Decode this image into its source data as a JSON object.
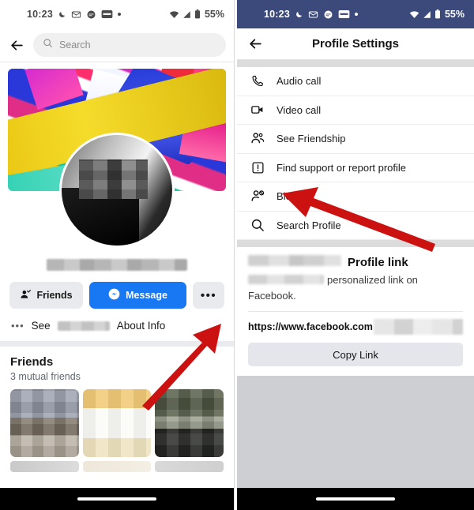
{
  "meta": {
    "accent_blue": "#1877f2",
    "status_bar_dark": "#3b4a7a",
    "arrow_red": "#cc1111",
    "button_gray": "#e4e6eb"
  },
  "status_bar": {
    "time": "10:23",
    "battery_percent": "55%",
    "icons_left": [
      "do-not-disturb-moon-icon",
      "email-icon",
      "chat-bubble-icon",
      "card-icon",
      "dot-icon"
    ],
    "icons_right": [
      "wifi-icon",
      "cellular-signal-icon",
      "battery-icon"
    ]
  },
  "left_panel": {
    "search": {
      "placeholder": "Search",
      "back_icon": "back-arrow-icon",
      "search_icon": "search-icon"
    },
    "profile": {
      "cover_photo_alt": "abstract-paint-cover-photo",
      "avatar_alt": "profile-avatar-blurred",
      "name_redacted": ""
    },
    "actions": {
      "friends_label": "Friends",
      "message_label": "Message",
      "more_label": "•••"
    },
    "see_about": {
      "prefix": "See",
      "suffix": "About Info",
      "icon": "more-dots-icon"
    },
    "friends_section": {
      "title": "Friends",
      "subtitle": "3 mutual friends",
      "thumbnails": [
        "friend-photo-1",
        "friend-photo-2",
        "friend-photo-3"
      ]
    }
  },
  "right_panel": {
    "header": {
      "title": "Profile Settings",
      "back_icon": "back-arrow-icon"
    },
    "menu_items": [
      {
        "label": "Audio call",
        "icon": "phone-icon"
      },
      {
        "label": "Video call",
        "icon": "video-camera-icon"
      },
      {
        "label": "See Friendship",
        "icon": "people-icon"
      },
      {
        "label": "Find support or report profile",
        "icon": "exclamation-box-icon"
      },
      {
        "label": "Block",
        "icon": "block-person-icon"
      },
      {
        "label": "Search Profile",
        "icon": "search-icon"
      }
    ],
    "profile_link": {
      "title": "Profile link",
      "description_tail": "personalized link on Facebook.",
      "url_prefix": "https://www.facebook.com",
      "copy_label": "Copy Link"
    }
  },
  "annotations": {
    "left_arrow_target": "more-options-button",
    "right_arrow_target": "block-menu-item"
  }
}
